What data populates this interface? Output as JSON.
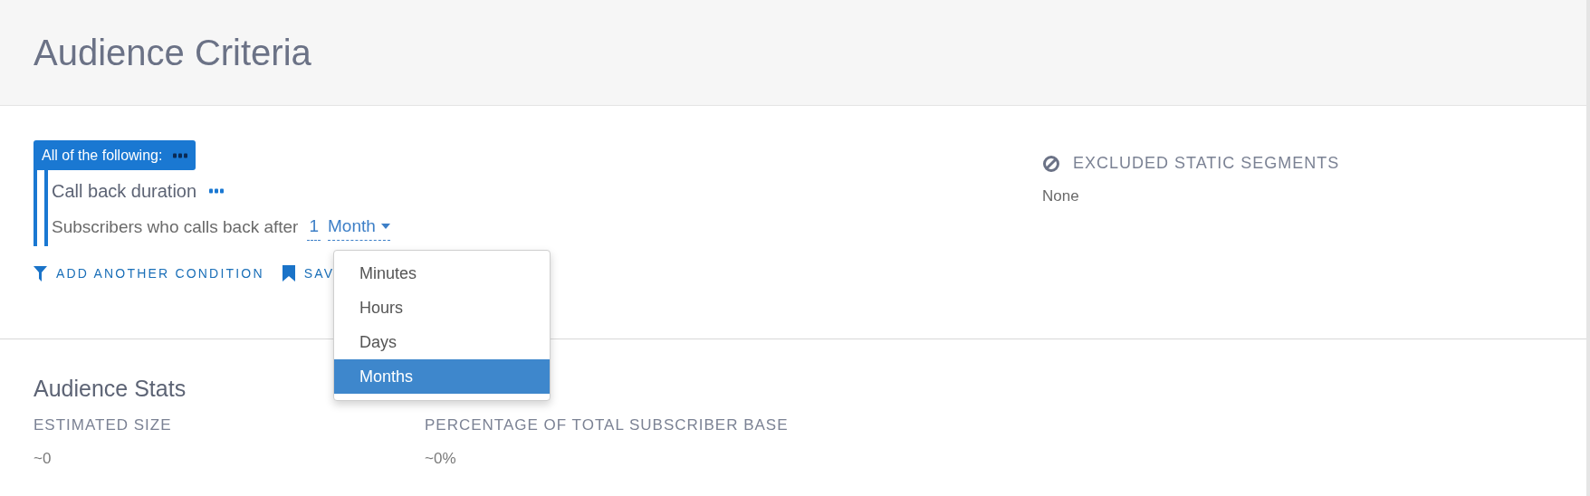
{
  "header": {
    "title": "Audience Criteria"
  },
  "criteria": {
    "group": {
      "label": "All of the following:"
    },
    "condition": {
      "title": "Call back duration",
      "sentence": "Subscribers who calls back after",
      "amount": "1",
      "unit": "Month",
      "unit_menu": [
        {
          "label": "Minutes",
          "selected": false
        },
        {
          "label": "Hours",
          "selected": false
        },
        {
          "label": "Days",
          "selected": false
        },
        {
          "label": "Months",
          "selected": true
        }
      ]
    },
    "actions": [
      {
        "kind": "filter",
        "label": "ADD ANOTHER CONDITION"
      },
      {
        "kind": "bookmark",
        "label": "SAV"
      }
    ]
  },
  "excluded": {
    "title": "EXCLUDED STATIC SEGMENTS",
    "value": "None"
  },
  "stats": {
    "title": "Audience Stats",
    "items": [
      {
        "label": "ESTIMATED SIZE",
        "value": "~0"
      },
      {
        "label": "PERCENTAGE OF TOTAL SUBSCRIBER BASE",
        "value": "~0%"
      }
    ]
  }
}
